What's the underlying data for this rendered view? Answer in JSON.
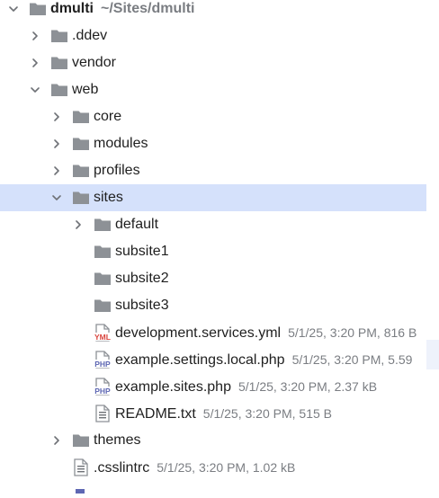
{
  "tree": {
    "items": [
      {
        "name": "dmulti",
        "meta": "~/Sites/dmulti",
        "type": "project",
        "depth": 0,
        "expanded": true
      },
      {
        "name": ".ddev",
        "type": "folder",
        "depth": 1,
        "expanded": false
      },
      {
        "name": "vendor",
        "type": "folder",
        "depth": 1,
        "expanded": false
      },
      {
        "name": "web",
        "type": "folder",
        "depth": 1,
        "expanded": true
      },
      {
        "name": "core",
        "type": "folder",
        "depth": 2,
        "expanded": false
      },
      {
        "name": "modules",
        "type": "folder",
        "depth": 2,
        "expanded": false
      },
      {
        "name": "profiles",
        "type": "folder",
        "depth": 2,
        "expanded": false
      },
      {
        "name": "sites",
        "type": "folder",
        "depth": 2,
        "expanded": true,
        "selected": true
      },
      {
        "name": "default",
        "type": "folder",
        "depth": 3,
        "expanded": false
      },
      {
        "name": "subsite1",
        "type": "folder",
        "depth": 3,
        "leaf": true
      },
      {
        "name": "subsite2",
        "type": "folder",
        "depth": 3,
        "leaf": true
      },
      {
        "name": "subsite3",
        "type": "folder",
        "depth": 3,
        "leaf": true
      },
      {
        "name": "development.services.yml",
        "meta": "5/1/25, 3:20 PM, 816 B",
        "type": "yml",
        "depth": 3
      },
      {
        "name": "example.settings.local.php",
        "meta": "5/1/25, 3:20 PM, 5.59",
        "type": "php",
        "depth": 3
      },
      {
        "name": "example.sites.php",
        "meta": "5/1/25, 3:20 PM, 2.37 kB",
        "type": "php",
        "depth": 3
      },
      {
        "name": "README.txt",
        "meta": "5/1/25, 3:20 PM, 515 B",
        "type": "text",
        "depth": 3
      },
      {
        "name": "themes",
        "type": "folder",
        "depth": 2,
        "expanded": false
      },
      {
        "name": ".csslintrc",
        "meta": "5/1/25, 3:20 PM, 1.02 kB",
        "type": "text",
        "depth": 2
      }
    ],
    "icons": {
      "folder": "folder-icon",
      "project": "folder-icon",
      "yml": "yml-file-icon",
      "php": "php-file-icon",
      "text": "text-file-icon"
    },
    "colors": {
      "selection": "#d5e1fb",
      "folder": "#8d9196",
      "chevron": "#6e7176",
      "meta_text": "#7a7d82",
      "yml_badge": "#d9443d",
      "php_badge": "#5e67b3"
    }
  }
}
